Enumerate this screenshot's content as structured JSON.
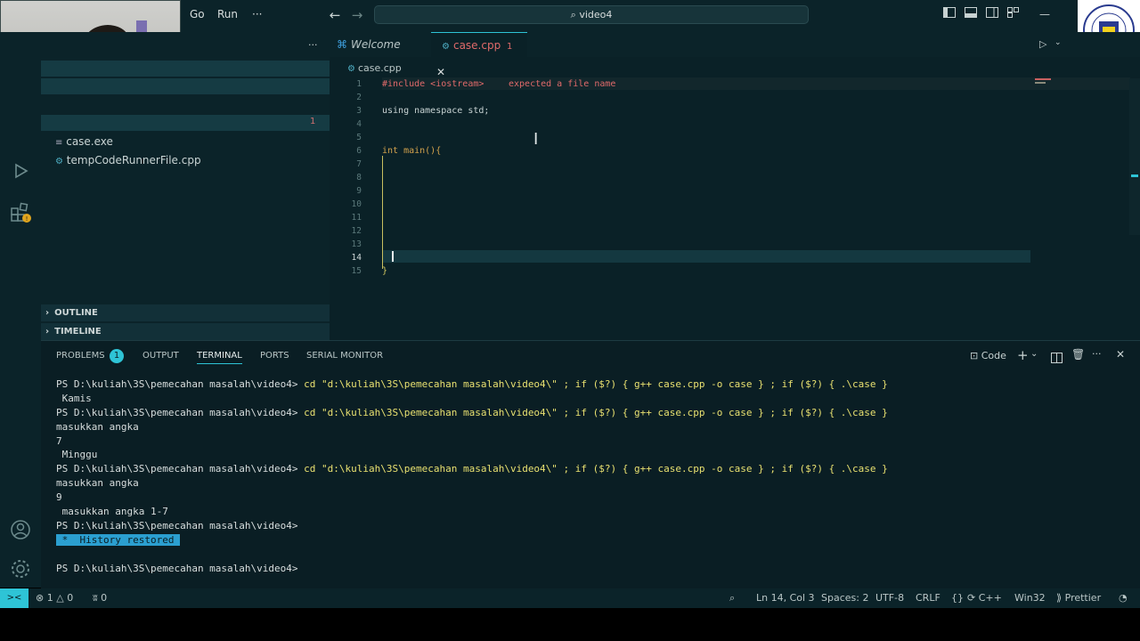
{
  "titlebar": {
    "menu": [
      "Go",
      "Run",
      "···"
    ],
    "search": "video4"
  },
  "sidebar": {
    "files": [
      {
        "icon": "list-icon",
        "name": "case.exe"
      },
      {
        "icon": "gear-file-icon",
        "name": "tempCodeRunnerFile.cpp"
      }
    ],
    "badge": "1",
    "outline_label": "OUTLINE",
    "timeline_label": "TIMELINE"
  },
  "tabs": [
    {
      "label": "Welcome",
      "active": false
    },
    {
      "label": "case.cpp",
      "badge": "1",
      "active": true
    }
  ],
  "breadcrumb": "case.cpp",
  "editor": {
    "lines": [
      {
        "n": "1",
        "text": "#include <iostream>",
        "error": "expected a file name"
      },
      {
        "n": "2",
        "text": ""
      },
      {
        "n": "3",
        "text": "using namespace std;"
      },
      {
        "n": "4",
        "text": ""
      },
      {
        "n": "5",
        "text": ""
      },
      {
        "n": "6",
        "text": "int main(){"
      },
      {
        "n": "7",
        "text": ""
      },
      {
        "n": "8",
        "text": ""
      },
      {
        "n": "9",
        "text": ""
      },
      {
        "n": "10",
        "text": ""
      },
      {
        "n": "11",
        "text": ""
      },
      {
        "n": "12",
        "text": ""
      },
      {
        "n": "13",
        "text": ""
      },
      {
        "n": "14",
        "text": ""
      },
      {
        "n": "15",
        "text": "}"
      }
    ]
  },
  "panel": {
    "tabs": [
      "PROBLEMS",
      "OUTPUT",
      "TERMINAL",
      "PORTS",
      "SERIAL MONITOR"
    ],
    "problems_count": "1",
    "active_tab": "TERMINAL",
    "terminal_name": "Code",
    "prompt": "PS D:\\kuliah\\3S\\pemecahan masalah\\video4>",
    "command": "cd \"d:\\kuliah\\3S\\pemecahan masalah\\video4\\\" ; if ($?) { g++ case.cpp -o case } ; if ($?) { .\\case }",
    "output": {
      "kamis": " Kamis",
      "masukkan": "masukkan angka",
      "seven": "7",
      "minggu": " Minggu",
      "nine": "9",
      "range": " masukkan angka 1-7",
      "history": " *  History restored "
    }
  },
  "statusbar": {
    "remote": "><",
    "errors": "1",
    "warnings": "0",
    "ports": "0",
    "position": "Ln 14, Col 3",
    "spaces": "Spaces: 2",
    "encoding": "UTF-8",
    "eol": "CRLF",
    "language": "C++",
    "platform": "Win32",
    "formatter": "Prettier"
  },
  "colors": {
    "accent": "#2ec4d6",
    "error": "#e06a6a",
    "keyword": "#d2a24c"
  }
}
